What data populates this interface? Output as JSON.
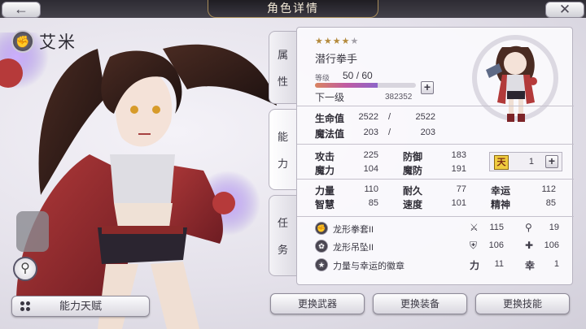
{
  "header": {
    "title": "角色详情",
    "back_icon": "back-arrow-icon",
    "close_icon": "close-x-icon"
  },
  "character": {
    "name": "艾米",
    "emblem_icon": "fist-emblem-icon"
  },
  "talent_button": {
    "label": "能力天赋",
    "icon": "four-dots-icon"
  },
  "zoom_icon": "magnifier-icon",
  "tabs": [
    {
      "chars": [
        "属",
        "性"
      ]
    },
    {
      "chars": [
        "能",
        "力"
      ]
    },
    {
      "chars": [
        "任",
        "务"
      ]
    }
  ],
  "profile": {
    "stars_filled": 4,
    "stars_total": 5,
    "class": "潜行拳手",
    "level_label": "等级",
    "level": "50",
    "level_max": "60",
    "exp_progress": 0.62,
    "next_label": "下一级",
    "next_exp": "382352"
  },
  "vitals": [
    {
      "label": "生命值",
      "current": "2522",
      "max": "2522"
    },
    {
      "label": "魔法值",
      "current": "203",
      "max": "203"
    }
  ],
  "combat_stats": [
    {
      "label": "攻击",
      "value": "225"
    },
    {
      "label": "防御",
      "value": "183"
    },
    {
      "label": "魔力",
      "value": "104"
    },
    {
      "label": "魔防",
      "value": "191"
    }
  ],
  "badge": {
    "icon_text": "天",
    "count": "1"
  },
  "attributes": [
    {
      "label": "力量",
      "value": "110"
    },
    {
      "label": "耐久",
      "value": "77"
    },
    {
      "label": "幸运",
      "value": "112"
    },
    {
      "label": "智慧",
      "value": "85"
    },
    {
      "label": "速度",
      "value": "101"
    },
    {
      "label": "精神",
      "value": "85"
    }
  ],
  "equipment": [
    {
      "name": "龙形拳套II",
      "icon": "fist-icon",
      "stat1_icon": "sword-icon",
      "stat1": "115",
      "stat2_icon": "wand-icon",
      "stat2": "19"
    },
    {
      "name": "龙形吊坠II",
      "icon": "pendant-icon",
      "stat1_icon": "shield-icon",
      "stat1": "106",
      "stat2_icon": "cross-shield-icon",
      "stat2": "106"
    },
    {
      "name": "力量与幸运的徽章",
      "icon": "badge-icon",
      "stat1_icon": "力",
      "stat1": "11",
      "stat2_icon": "幸",
      "stat2": "1"
    }
  ],
  "bottom_buttons": [
    "更换武器",
    "更换装备",
    "更换技能"
  ],
  "colors": {
    "panel_bg": "#f9f8fb",
    "exp_gradient_start": "#d9845f",
    "exp_gradient_end": "#8d65c9",
    "star_on": "#b48a3c"
  }
}
